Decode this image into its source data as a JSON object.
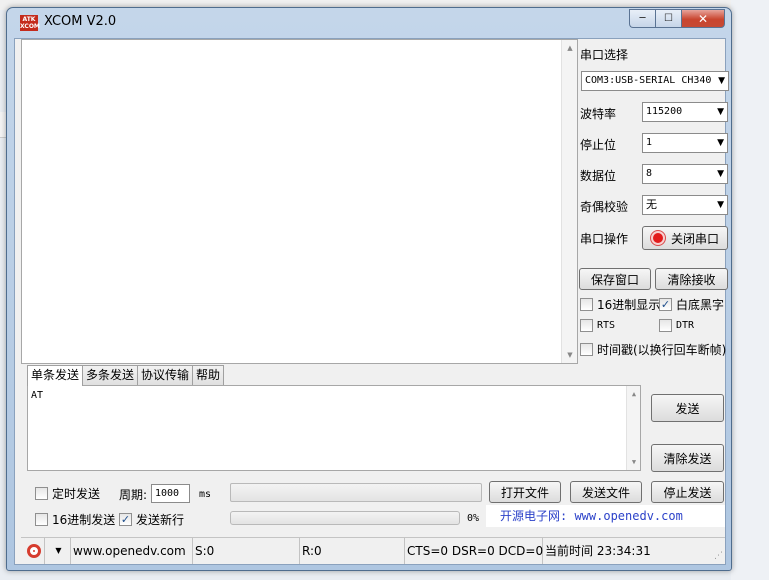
{
  "window": {
    "title": "XCOM V2.0",
    "logo_text": "ATK XCOM"
  },
  "window_buttons": {
    "minimize": "─",
    "maximize": "☐",
    "close": "✕"
  },
  "right_panel": {
    "port_label": "串口选择",
    "port_value": "COM3:USB-SERIAL CH340",
    "baud_label": "波特率",
    "baud_value": "115200",
    "stop_label": "停止位",
    "stop_value": "1",
    "data_label": "数据位",
    "data_value": "8",
    "parity_label": "奇偶校验",
    "parity_value": "无",
    "op_label": "串口操作",
    "op_button": "关闭串口",
    "save_window": "保存窗口",
    "clear_recv": "清除接收",
    "hex_display": "16进制显示",
    "white_bg": "白底黑字",
    "rts": "RTS",
    "dtr": "DTR",
    "timestamp": "时间戳(以换行回车断帧)"
  },
  "tabs": [
    "单条发送",
    "多条发送",
    "协议传输",
    "帮助"
  ],
  "send": {
    "text": "AT",
    "send_button": "发送",
    "clear_send_button": "清除发送",
    "timed_send": "定时发送",
    "period_label": "周期:",
    "period_value": "1000",
    "period_unit": "ms",
    "open_file": "打开文件",
    "send_file": "发送文件",
    "stop_send": "停止发送",
    "hex_send": "16进制发送",
    "send_newline": "发送新行",
    "progress_percent": "0%",
    "site_text": "开源电子网: www.openedv.com"
  },
  "status_bar": {
    "url": "www.openedv.com",
    "sent": "S:0",
    "received": "R:0",
    "signals": "CTS=0 DSR=0 DCD=0",
    "time": "当前时间 23:34:31"
  },
  "checkbox_states": {
    "hex_display": false,
    "white_bg": true,
    "rts": false,
    "dtr": false,
    "timestamp": false,
    "timed_send": false,
    "hex_send": false,
    "send_newline": true
  },
  "colors": {
    "accent_red": "#e21b1b",
    "link_blue": "#2c42c9"
  }
}
